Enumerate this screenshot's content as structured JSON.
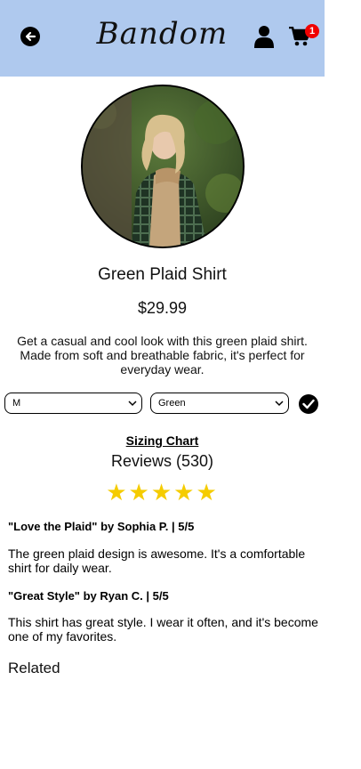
{
  "header": {
    "brand": "Bandom",
    "cart_count": "1"
  },
  "product": {
    "name": "Green Plaid Shirt",
    "price": "$29.99",
    "description": "Get a casual and cool look with this green plaid shirt. Made from soft and breathable fabric, it's perfect for everyday wear."
  },
  "options": {
    "size_selected": "M",
    "color_selected": "Green"
  },
  "sizing_chart_label": "Sizing Chart",
  "reviews": {
    "title": "Reviews (530)",
    "stars": "★★★★★",
    "rating": 5,
    "items": [
      {
        "heading": "\"Love the Plaid\" by Sophia P. | 5/5",
        "body": "The green plaid design is awesome. It's a comfortable shirt for daily wear."
      },
      {
        "heading": "\"Great Style\" by Ryan C. | 5/5",
        "body": "This shirt has great style. I wear it often, and it's become one of my favorites."
      }
    ]
  },
  "related_title": "Related",
  "colors": {
    "header_bg": "#afc9ee",
    "badge": "#f00000",
    "stars": "#f5cc00"
  },
  "icons": [
    "back-arrow-icon",
    "user-icon",
    "cart-icon",
    "chevron-down-icon",
    "check-icon"
  ]
}
